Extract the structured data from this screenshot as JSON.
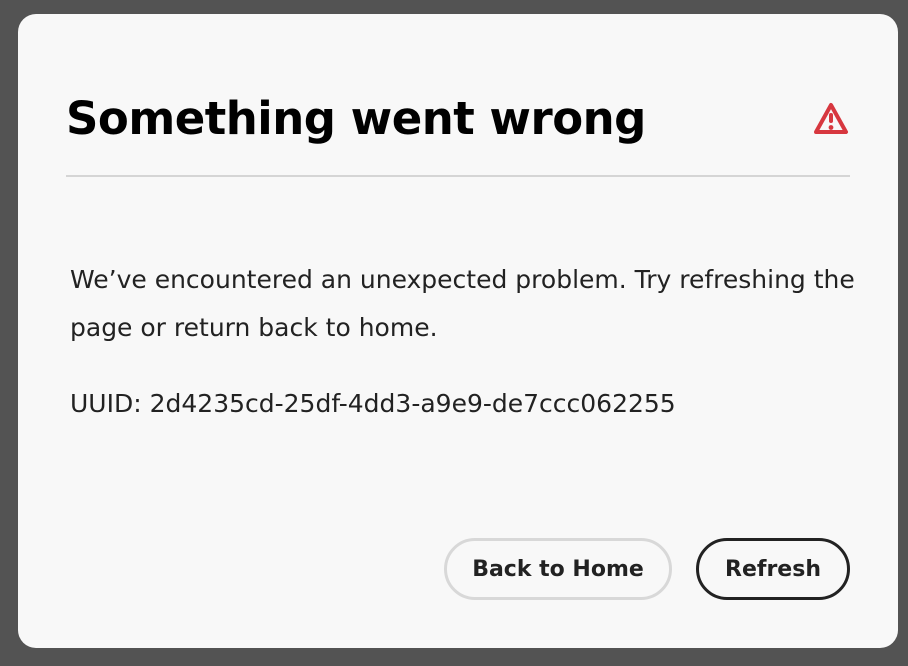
{
  "dialog": {
    "title": "Something went wrong",
    "alert_icon": "alert-triangle-icon",
    "alert_color": "#d7373f",
    "message": "We’ve encountered an unexpected problem. Try refreshing the page or return back to home.",
    "uuid_label": "UUID:",
    "uuid_value": "2d4235cd-25df-4dd3-a9e9-de7ccc062255",
    "buttons": {
      "back_home": "Back to Home",
      "refresh": "Refresh"
    }
  }
}
